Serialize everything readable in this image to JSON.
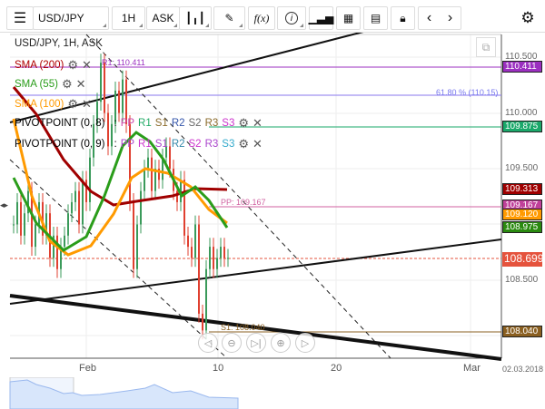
{
  "toolbar": {
    "symbol": "USD/JPY",
    "interval": "1H",
    "price_type": "ASK",
    "fx_label": "f(x)",
    "info_label": "i"
  },
  "chart": {
    "title": "USD/JPY, 1H, ASK",
    "indicators": [
      {
        "label": "SMA (200)",
        "color": "#b00000"
      },
      {
        "label": "SMA (55)",
        "color": "#2a9d1a"
      },
      {
        "label": "SMA (100)",
        "color": "#ff9a00"
      }
    ],
    "pivots": [
      {
        "label": "PIVOTPOINT (0, 8)",
        "sep": ":",
        "levels": [
          {
            "t": "PP",
            "c": "#cc44aa"
          },
          {
            "t": "R1",
            "c": "#22aa66"
          },
          {
            "t": "S1",
            "c": "#8a6a2a"
          },
          {
            "t": "R2",
            "c": "#3355aa"
          },
          {
            "t": "S2",
            "c": "#666"
          },
          {
            "t": "R3",
            "c": "#8a6a2a"
          },
          {
            "t": "S3",
            "c": "#cc33cc"
          }
        ]
      },
      {
        "label": "PIVOTPOINT (0, 9)",
        "sep": ":",
        "levels": [
          {
            "t": "PP",
            "c": "#aa44cc"
          },
          {
            "t": "R1",
            "c": "#cc33cc"
          },
          {
            "t": "S1",
            "c": "#aa44cc"
          },
          {
            "t": "R2",
            "c": "#3388aa"
          },
          {
            "t": "S2",
            "c": "#cc33cc"
          },
          {
            "t": "R3",
            "c": "#aa44cc"
          },
          {
            "t": "S3",
            "c": "#33aacc"
          }
        ]
      }
    ],
    "fib_label": "61.80 % (110.15)",
    "pp_label": "PP: 109.167",
    "s1_label": "S1: 108.040",
    "r_label": "R1: 110.411",
    "price_ticks": [
      "110.500",
      "110.000",
      "109.500",
      "108.500"
    ],
    "price_labels": [
      {
        "v": "110.411",
        "c": "#9b2fc0"
      },
      {
        "v": "109.875",
        "c": "#1aa86a"
      },
      {
        "v": "109.313",
        "c": "#a00000"
      },
      {
        "v": "109.167",
        "c": "#c0409a"
      },
      {
        "v": "109.120",
        "c": "#ff9a00"
      },
      {
        "v": "108.975",
        "c": "#2a8a10"
      },
      {
        "v": "108.699",
        "c": "#e5533d"
      },
      {
        "v": "108.040",
        "c": "#8a5f20"
      }
    ],
    "x_ticks": [
      "Feb",
      "10",
      "20",
      "Mar"
    ],
    "date_label": "02.03.2018",
    "closes": [
      109.0,
      109.2,
      108.9,
      109.1,
      109.3,
      108.8,
      109.0,
      109.2,
      108.9,
      109.1,
      108.7,
      108.9,
      108.6,
      108.8,
      108.9,
      109.1,
      109.2,
      109.3,
      109.0,
      109.4,
      109.2,
      109.6,
      109.9,
      110.1,
      110.45,
      110.0,
      109.7,
      109.9,
      110.2,
      110.0,
      110.3,
      109.9,
      109.2,
      108.6,
      109.0,
      109.3,
      109.5,
      109.6,
      109.3,
      109.5,
      109.4,
      109.6,
      109.7,
      109.5,
      109.3,
      109.2,
      109.4,
      108.9,
      108.8,
      108.7,
      109.0,
      108.2,
      108.05,
      108.6,
      108.8,
      108.6,
      108.7,
      108.8,
      108.7,
      108.7
    ]
  }
}
